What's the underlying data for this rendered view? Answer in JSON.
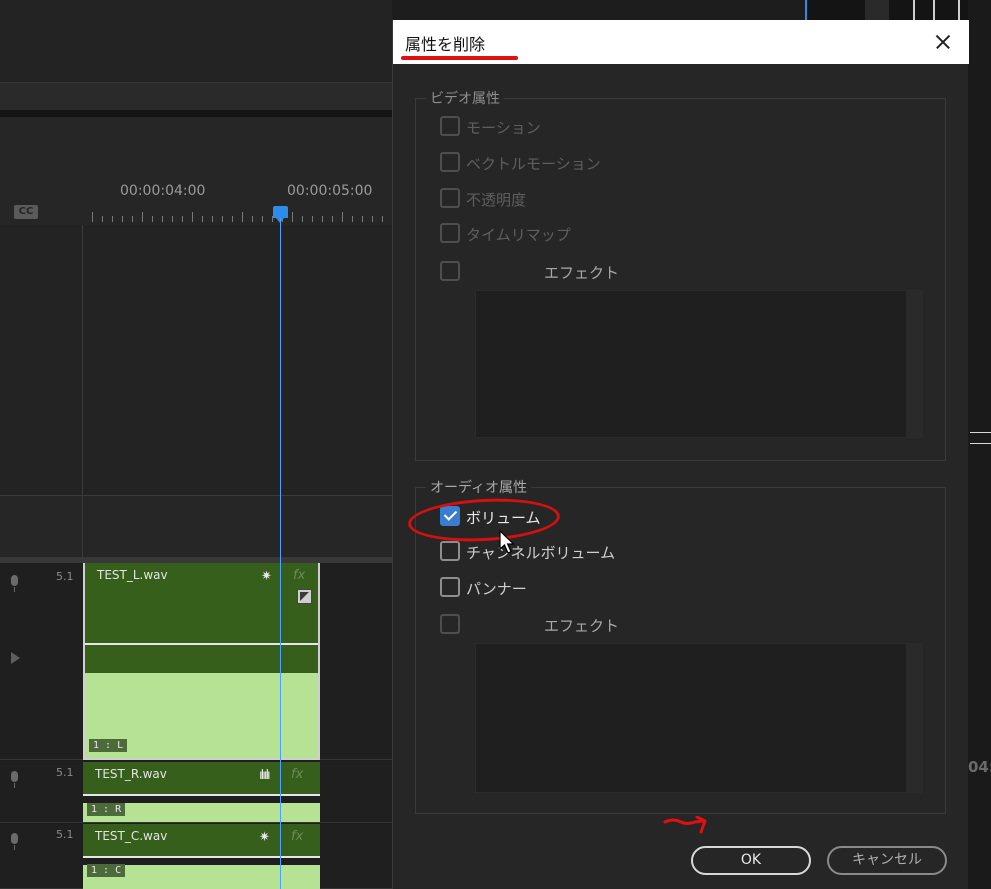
{
  "timeline": {
    "timecodes": [
      "00:00:04:00",
      "00:00:05:00"
    ],
    "cc_label": "CC",
    "tracks": [
      {
        "channel_format": "5.1",
        "clip_name": "TEST_L.wav",
        "channel_label": "1 : L"
      },
      {
        "channel_format": "5.1",
        "clip_name": "TEST_R.wav",
        "channel_label": "1 : R"
      },
      {
        "channel_format": "5.1",
        "clip_name": "TEST_C.wav",
        "channel_label": "1 : C"
      }
    ],
    "fx_label": "fx",
    "right_edge_timecode": "04:",
    "playhead_color": "#2d8ceb"
  },
  "dialog": {
    "title": "属性を削除",
    "video_group": {
      "legend": "ビデオ属性",
      "items": [
        {
          "label": "モーション",
          "checked": false,
          "enabled": false
        },
        {
          "label": "ベクトルモーション",
          "checked": false,
          "enabled": false
        },
        {
          "label": "不透明度",
          "checked": false,
          "enabled": false
        },
        {
          "label": "タイムリマップ",
          "checked": false,
          "enabled": false
        },
        {
          "label": "エフェクト",
          "checked": false,
          "enabled": false
        }
      ]
    },
    "audio_group": {
      "legend": "オーディオ属性",
      "items": [
        {
          "label": "ボリューム",
          "checked": true,
          "enabled": true
        },
        {
          "label": "チャンネルボリューム",
          "checked": false,
          "enabled": true
        },
        {
          "label": "パンナー",
          "checked": false,
          "enabled": true
        },
        {
          "label": "エフェクト",
          "checked": false,
          "enabled": false
        }
      ]
    },
    "ok_label": "OK",
    "cancel_label": "キャンセル",
    "accent_color": "#3a7dd0",
    "annotation_color": "#d61010"
  }
}
